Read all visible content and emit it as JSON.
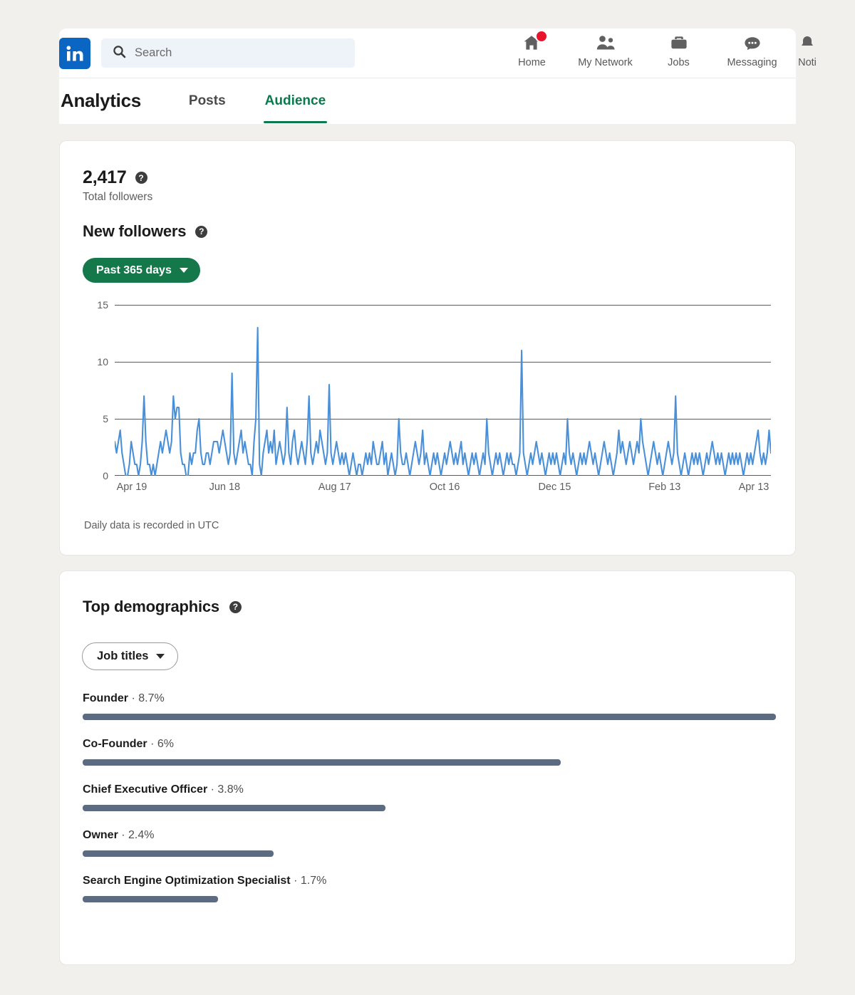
{
  "nav": {
    "logo_icon": "linkedin-logo-icon",
    "search": {
      "icon": "search-icon",
      "placeholder": "Search",
      "value": ""
    },
    "items": [
      {
        "label": "Home",
        "icon": "home-icon",
        "badge": true
      },
      {
        "label": "My Network",
        "icon": "my-network-icon",
        "badge": false
      },
      {
        "label": "Jobs",
        "icon": "jobs-briefcase-icon",
        "badge": false
      },
      {
        "label": "Messaging",
        "icon": "messaging-icon",
        "badge": false
      },
      {
        "label": "Noti",
        "icon": "notifications-bell-icon",
        "badge": false
      }
    ]
  },
  "header": {
    "title": "Analytics",
    "tabs": [
      {
        "label": "Posts",
        "active": false
      },
      {
        "label": "Audience",
        "active": true
      }
    ],
    "active_tab_color": "#0A7A4E"
  },
  "followers_card": {
    "total_value": "2,417",
    "total_label": "Total followers",
    "total_help_icon": "help-icon",
    "section_title": "New followers",
    "section_help_icon": "help-icon",
    "date_range_label": "Past 365 days",
    "date_range_caret_icon": "chevron-down-icon",
    "footnote": "Daily data is recorded in UTC"
  },
  "chart_data": {
    "type": "line",
    "title": "New followers",
    "xlabel": "",
    "ylabel": "",
    "ylim": [
      0,
      15
    ],
    "yticks": [
      0,
      5,
      10,
      15
    ],
    "grid": true,
    "legend": false,
    "line_color": "#4A90D9",
    "x_tick_labels": [
      "Apr 19",
      "Jun 18",
      "Aug 17",
      "Oct 16",
      "Dec 15",
      "Feb 13",
      "Apr 13"
    ],
    "x_tick_positions": [
      0,
      60,
      120,
      180,
      240,
      300,
      359
    ],
    "note": "Daily new-follower counts over the past 365 days",
    "values": [
      3,
      2,
      3,
      4,
      2,
      1,
      0,
      0,
      1,
      3,
      2,
      1,
      1,
      0,
      1,
      3,
      7,
      3,
      1,
      1,
      0,
      1,
      0,
      1,
      2,
      3,
      2,
      3,
      4,
      3,
      2,
      3,
      7,
      5,
      6,
      6,
      2,
      1,
      1,
      0,
      0,
      2,
      1,
      2,
      2,
      4,
      5,
      2,
      1,
      1,
      2,
      2,
      1,
      2,
      3,
      3,
      3,
      2,
      3,
      4,
      3,
      2,
      1,
      2,
      9,
      2,
      1,
      2,
      3,
      4,
      2,
      3,
      2,
      1,
      1,
      0,
      3,
      5,
      13,
      1,
      0,
      2,
      3,
      4,
      2,
      3,
      2,
      4,
      1,
      2,
      3,
      2,
      1,
      2,
      6,
      2,
      1,
      3,
      4,
      2,
      1,
      2,
      3,
      2,
      1,
      3,
      7,
      2,
      1,
      2,
      3,
      2,
      4,
      3,
      2,
      1,
      2,
      8,
      2,
      1,
      2,
      3,
      2,
      1,
      2,
      1,
      2,
      1,
      0,
      1,
      2,
      1,
      0,
      1,
      1,
      0,
      1,
      2,
      1,
      2,
      1,
      3,
      2,
      1,
      1,
      2,
      3,
      1,
      2,
      0,
      1,
      2,
      1,
      0,
      1,
      5,
      2,
      1,
      1,
      2,
      1,
      0,
      1,
      2,
      3,
      2,
      1,
      2,
      4,
      1,
      2,
      1,
      0,
      1,
      2,
      1,
      2,
      1,
      0,
      1,
      2,
      1,
      2,
      3,
      2,
      1,
      2,
      1,
      2,
      3,
      1,
      2,
      1,
      0,
      1,
      2,
      1,
      2,
      1,
      0,
      1,
      2,
      1,
      5,
      2,
      1,
      0,
      1,
      2,
      1,
      2,
      1,
      0,
      1,
      2,
      1,
      2,
      1,
      1,
      0,
      1,
      2,
      11,
      2,
      1,
      0,
      1,
      2,
      1,
      2,
      3,
      2,
      1,
      2,
      1,
      0,
      1,
      2,
      1,
      2,
      1,
      2,
      1,
      0,
      1,
      2,
      1,
      5,
      2,
      1,
      2,
      1,
      0,
      1,
      2,
      1,
      2,
      1,
      2,
      3,
      2,
      1,
      2,
      1,
      0,
      1,
      2,
      3,
      2,
      1,
      2,
      1,
      0,
      1,
      2,
      4,
      2,
      3,
      2,
      1,
      2,
      3,
      2,
      1,
      2,
      3,
      2,
      5,
      3,
      2,
      1,
      0,
      1,
      2,
      3,
      2,
      1,
      2,
      1,
      0,
      1,
      2,
      3,
      2,
      1,
      2,
      7,
      2,
      1,
      0,
      1,
      2,
      1,
      0,
      1,
      2,
      1,
      2,
      1,
      2,
      1,
      0,
      1,
      2,
      1,
      2,
      3,
      2,
      1,
      2,
      1,
      2,
      1,
      0,
      1,
      2,
      1,
      2,
      1,
      2,
      1,
      2,
      1,
      0,
      1,
      2,
      1,
      2,
      1,
      2,
      3,
      4,
      2,
      1,
      2,
      1,
      2,
      4,
      2
    ]
  },
  "demographics_card": {
    "title": "Top demographics",
    "help_icon": "help-icon",
    "filter_label": "Job titles",
    "filter_caret_icon": "chevron-down-icon",
    "bar_color": "#5C6B80",
    "separator": "·",
    "rows": [
      {
        "name": "Founder",
        "percent": "8.7%",
        "value": 8.7
      },
      {
        "name": "Co-Founder",
        "percent": "6%",
        "value": 6.0
      },
      {
        "name": "Chief Executive Officer",
        "percent": "3.8%",
        "value": 3.8
      },
      {
        "name": "Owner",
        "percent": "2.4%",
        "value": 2.4
      },
      {
        "name": "Search Engine Optimization Specialist",
        "percent": "1.7%",
        "value": 1.7
      }
    ]
  }
}
